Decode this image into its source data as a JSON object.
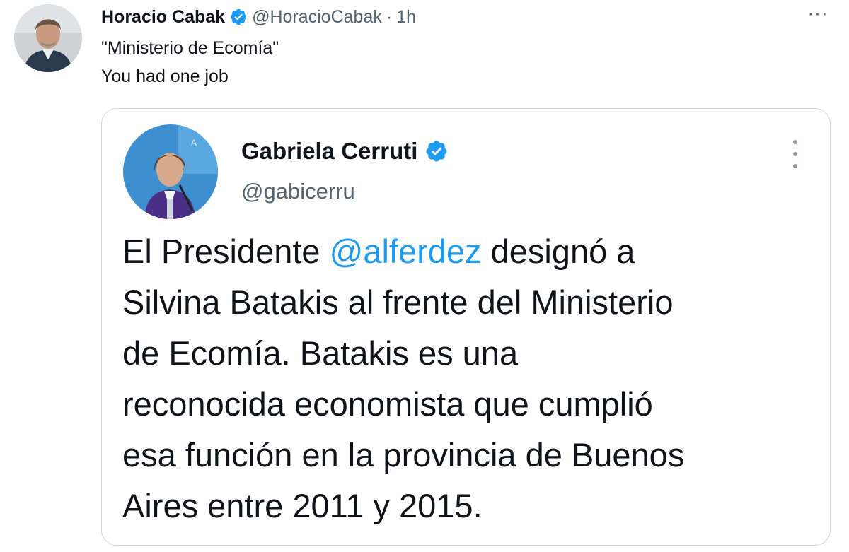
{
  "tweet": {
    "author_name": "Horacio Cabak",
    "author_handle": "@HoracioCabak",
    "separator": "·",
    "time": "1h",
    "more_label": "···",
    "text_lines": [
      "\"Ministerio de Ecomía\"",
      "You had one job"
    ],
    "avatar_icon": "avatar-photo-icon",
    "verified_icon": "verified-badge-icon"
  },
  "quoted_tweet": {
    "author_name": "Gabriela Cerruti",
    "author_handle": "@gabicerru",
    "avatar_icon": "avatar-photo-icon",
    "verified_icon": "verified-badge-icon",
    "text": {
      "line1_before": "El Presidente ",
      "mention": "@alferdez",
      "line1_after": " designó a",
      "line2": "Silvina Batakis al frente del Ministerio",
      "line3": "de Ecomía. Batakis es una",
      "line4": "reconocida economista que cumplió",
      "line5": "esa función en la provincia de Buenos",
      "line6": "Aires entre 2011 y 2015."
    }
  },
  "colors": {
    "text": "#0f1419",
    "secondary": "#536471",
    "accent": "#1d9bf0",
    "border": "#cfd9de"
  }
}
